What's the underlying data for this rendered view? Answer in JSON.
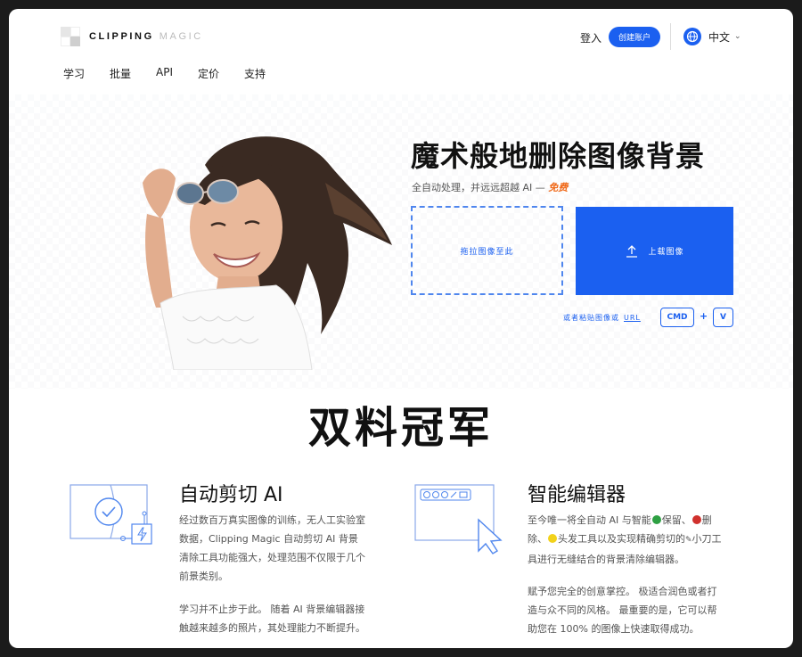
{
  "brand": {
    "name_a": "CLIPPING",
    "name_b": "MAGIC"
  },
  "header": {
    "login": "登入",
    "signup": "创建账户",
    "language": "中文"
  },
  "nav": [
    "学习",
    "批量",
    "API",
    "定价",
    "支持"
  ],
  "hero": {
    "title": "魔术般地删除图像背景",
    "subtitle": "全自动处理，并远远超越 AI — ",
    "subtitle_free": "免费",
    "drop_label": "拖拉图像至此",
    "upload_label": "上载图像",
    "paste_label": "或者粘贴图像或",
    "paste_url": "URL",
    "key_cmd": "CMD",
    "key_plus": "+",
    "key_v": "V"
  },
  "section": {
    "title": "双料冠军"
  },
  "features": [
    {
      "title": "自动剪切 AI",
      "para1": "经过数百万真实图像的训练，无人工实验室数据，Clipping Magic 自动剪切 AI 背景清除工具功能强大，处理范围不仅限于几个前景类别。",
      "para2": "学习并不止步于此。 随着 AI 背景编辑器接触越来越多的照片，其处理能力不断提升。"
    },
    {
      "title": "智能编辑器",
      "para1_a": "至今唯一将全自动 AI 与智能",
      "para1_b": "保留、",
      "para1_c": "删除、",
      "para1_d": "头发工具以及实现精确剪切的",
      "para1_e": "小刀工具进行无缝结合的背景清除编辑器。",
      "para2": "赋予您完全的创意掌控。 极适合润色或者打造与众不同的风格。 最重要的是，它可以帮助您在 100% 的图像上快速取得成功。"
    }
  ],
  "colors": {
    "accent": "#1b60f0",
    "free": "#f06a1a",
    "keep": "#2ea043",
    "remove": "#d0312d",
    "hair": "#f2d21b"
  }
}
